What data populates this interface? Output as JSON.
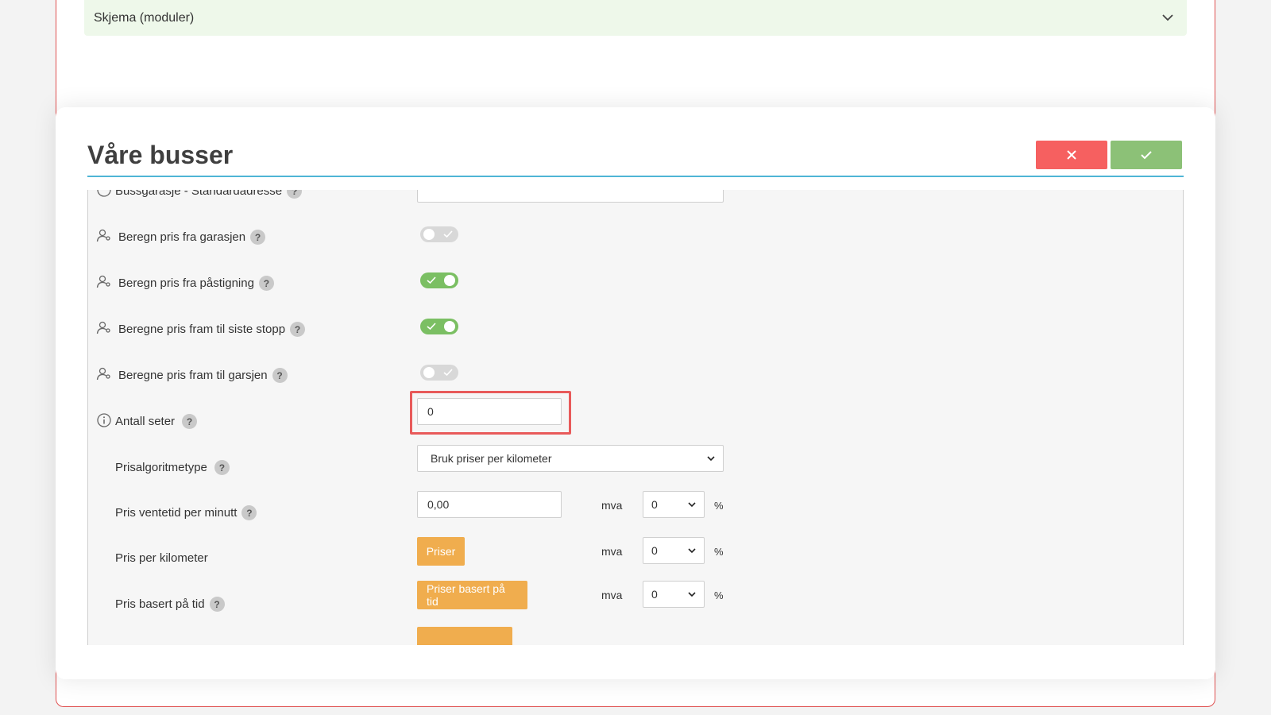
{
  "background": {
    "accordion_label": "Skjema (moduler)"
  },
  "modal": {
    "title": "Våre busser",
    "cancel_icon": "close-icon",
    "confirm_icon": "check-icon"
  },
  "form": {
    "cut_row_label": "Bussgarasje - Standardadresse",
    "rows": [
      {
        "label": "Beregn pris fra garasjen",
        "type": "toggle",
        "on": false
      },
      {
        "label": "Beregn pris fra påstigning",
        "type": "toggle",
        "on": true
      },
      {
        "label": "Beregne pris fram til siste stopp",
        "type": "toggle",
        "on": true
      },
      {
        "label": "Beregne pris fram til garsjen",
        "type": "toggle",
        "on": false
      }
    ],
    "seats": {
      "label": "Antall seter",
      "value": "0"
    },
    "algorithm": {
      "label": "Prisalgoritmetype",
      "selected": "Bruk priser per kilometer"
    },
    "wait_price": {
      "label": "Pris ventetid per minutt",
      "value": "0,00",
      "vat_label": "mva",
      "vat": "0",
      "unit": "%"
    },
    "km_price": {
      "label": "Pris per kilometer",
      "button": "Priser",
      "vat_label": "mva",
      "vat": "0",
      "unit": "%"
    },
    "time_price": {
      "label": "Pris basert på tid",
      "button": "Priser basert på tid",
      "vat_label": "mva",
      "vat": "0",
      "unit": "%"
    }
  },
  "colors": {
    "danger": "#f66060",
    "success": "#8cc177",
    "accent_rule": "#4fb5d6",
    "warning": "#f0ad4e",
    "highlight": "#e85a5a"
  }
}
